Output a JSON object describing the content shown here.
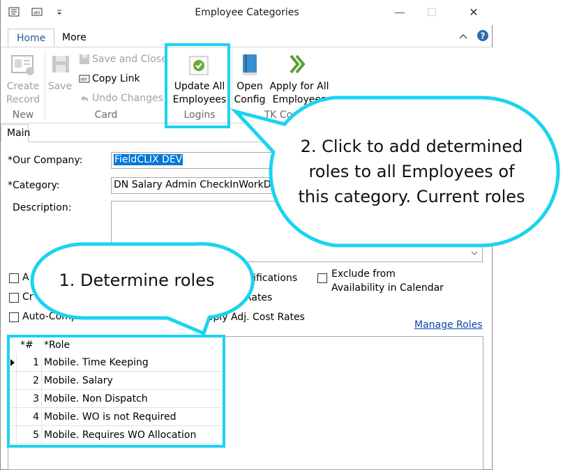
{
  "window": {
    "title": "Employee Categories"
  },
  "titlebar": {
    "minimize": "—",
    "maximize": "☐",
    "close": "✕"
  },
  "ribbon_tabs": [
    {
      "label": "Home"
    },
    {
      "label": "More"
    }
  ],
  "ribbon": {
    "new_group": {
      "create_record": "Create\nRecord",
      "label": "New",
      "create_line1": "Create",
      "create_line2": "Record"
    },
    "card_group": {
      "save": "Save",
      "save_and_close": "Save and Close",
      "copy_link": "Copy Link",
      "undo_changes": "Undo Changes",
      "label": "Card"
    },
    "logins_group": {
      "update_line1": "Update All",
      "update_line2": "Employees",
      "label": "Logins"
    },
    "tk_group": {
      "open_line1": "Open",
      "open_line2": "Config",
      "apply_line1": "Apply for All",
      "apply_line2": "Employees",
      "label_partial": "TK Co"
    }
  },
  "form": {
    "tab": "Main",
    "our_company": {
      "label": "*Our Company:",
      "value": "FieldCLIX DEV"
    },
    "category": {
      "label": "*Category:",
      "value": "DN Salary Admin CheckInWorkD"
    },
    "description": {
      "label": "Description:",
      "value": ""
    },
    "checkboxes": [
      {
        "label_visible": "A",
        "checked": false
      },
      {
        "label_visible": "otifications",
        "checked": false
      },
      {
        "label_line1": "Exclude from",
        "label_line2": "Availability in Calendar",
        "checked": false
      },
      {
        "label_visible": "Cr",
        "checked": false
      },
      {
        "label_visible": "t Rates",
        "checked": false
      },
      {
        "label_visible": "Auto-Complete TimeCards",
        "checked": false
      },
      {
        "label_visible": "Apply Adj. Cost Rates",
        "checked": false
      }
    ],
    "manage_roles": "Manage Roles"
  },
  "roles_grid": {
    "columns": [
      "*#",
      "*Role"
    ],
    "rows": [
      {
        "num": "1",
        "role": "Mobile. Time Keeping",
        "current": true
      },
      {
        "num": "2",
        "role": "Mobile. Salary",
        "current": false
      },
      {
        "num": "3",
        "role": "Mobile. Non Dispatch",
        "current": false
      },
      {
        "num": "4",
        "role": "Mobile. WO is not Required",
        "current": false
      },
      {
        "num": "5",
        "role": "Mobile. Requires WO Allocation",
        "current": false
      }
    ]
  },
  "callouts": {
    "one": "1. Determine roles",
    "two_line1": "2. Click to add determined",
    "two_line2": "roles to all Employees of",
    "two_line3": "this category. Current roles"
  },
  "colors": {
    "accent": "#2b579a",
    "highlight": "#1bd3f0",
    "selection": "#0078d7",
    "link": "#0645ad"
  }
}
